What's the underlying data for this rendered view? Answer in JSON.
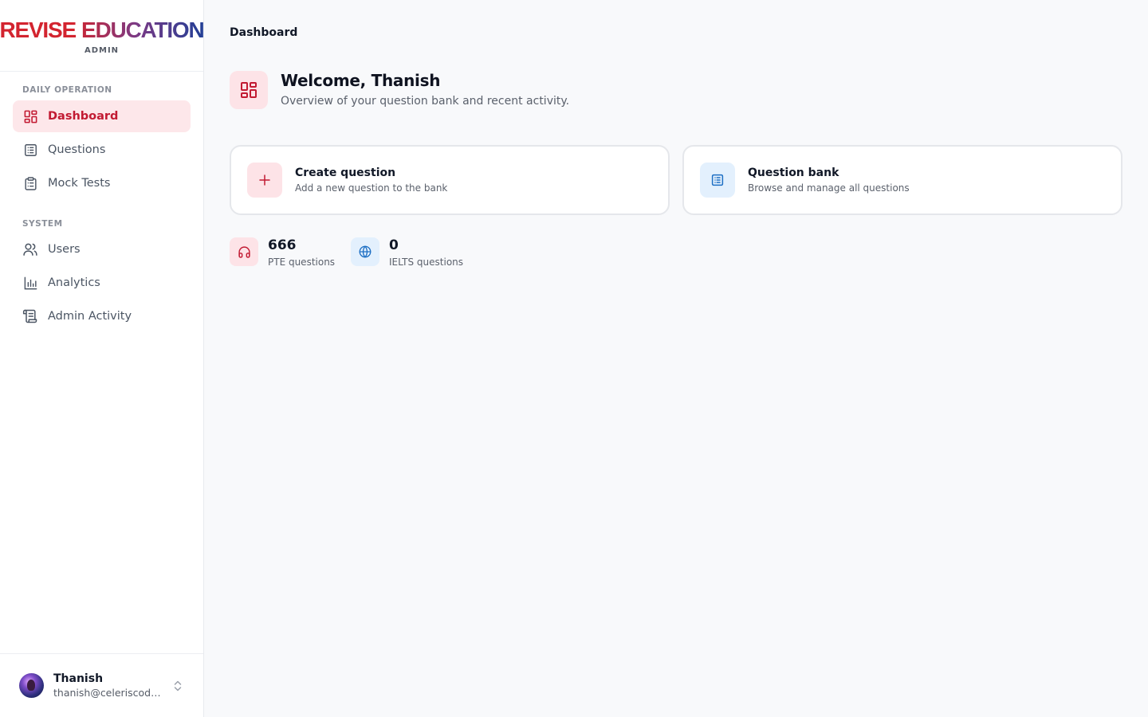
{
  "brand": {
    "word1": "REVISE",
    "word2": "EDUCATION",
    "subtitle": "ADMIN"
  },
  "sidebar": {
    "sections": [
      {
        "label": "DAILY OPERATION"
      },
      {
        "label": "SYSTEM"
      }
    ],
    "items": [
      {
        "label": "Dashboard",
        "icon": "dashboard-icon",
        "active": true
      },
      {
        "label": "Questions",
        "icon": "list-icon"
      },
      {
        "label": "Mock Tests",
        "icon": "clipboard-icon"
      },
      {
        "label": "Users",
        "icon": "users-icon"
      },
      {
        "label": "Analytics",
        "icon": "bar-chart-icon"
      },
      {
        "label": "Admin Activity",
        "icon": "scroll-icon"
      }
    ]
  },
  "user": {
    "name": "Thanish",
    "email": "thanish@celeriscode..."
  },
  "header": {
    "breadcrumb": "Dashboard"
  },
  "welcome": {
    "title": "Welcome, Thanish",
    "subtitle": "Overview of your question bank and recent activity."
  },
  "actions": [
    {
      "title": "Create question",
      "description": "Add a new question to the bank",
      "icon": "plus-icon"
    },
    {
      "title": "Question bank",
      "description": "Browse and manage all questions",
      "icon": "list-icon"
    }
  ],
  "stats": [
    {
      "value": "666",
      "label": "PTE questions",
      "icon": "headphones-icon"
    },
    {
      "value": "0",
      "label": "IELTS questions",
      "icon": "globe-icon"
    }
  ],
  "colors": {
    "accent": "#c21a32",
    "accent_bg": "#fde7ea",
    "blue": "#1d6fc4",
    "blue_bg": "#e3f0fd"
  }
}
